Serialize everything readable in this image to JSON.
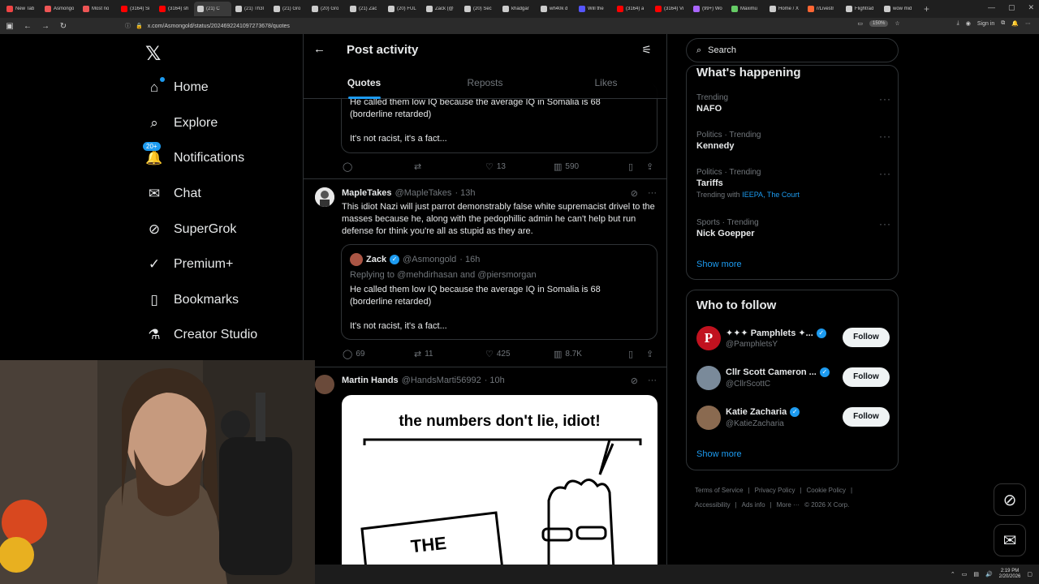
{
  "browser": {
    "tabs": [
      {
        "title": "New Tab",
        "color": "#e44"
      },
      {
        "title": "Asmongo",
        "color": "#e55"
      },
      {
        "title": "Most no",
        "color": "#e55"
      },
      {
        "title": "(3164) Si",
        "color": "#f00"
      },
      {
        "title": "(3164) sh",
        "color": "#f00"
      },
      {
        "title": "(21) C",
        "color": "#ccc",
        "active": true
      },
      {
        "title": "(21) Th3l",
        "color": "#ccc"
      },
      {
        "title": "(21) Gro",
        "color": "#ccc"
      },
      {
        "title": "(20) Gro",
        "color": "#ccc"
      },
      {
        "title": "(21) Zac",
        "color": "#ccc"
      },
      {
        "title": "(20) FUL",
        "color": "#ccc"
      },
      {
        "title": "Zack (@",
        "color": "#ccc"
      },
      {
        "title": "(20) Sec",
        "color": "#ccc"
      },
      {
        "title": "khadgar",
        "color": "#ccc"
      },
      {
        "title": "wh40k d",
        "color": "#ccc"
      },
      {
        "title": "Will the",
        "color": "#55f"
      },
      {
        "title": "(3164) a",
        "color": "#f00"
      },
      {
        "title": "(3164) Vi",
        "color": "#f00"
      },
      {
        "title": "(99+) Wo",
        "color": "#a6f"
      },
      {
        "title": "Maximu",
        "color": "#6c6"
      },
      {
        "title": "Home / X",
        "color": "#ccc"
      },
      {
        "title": "r/Livestr",
        "color": "#f63"
      },
      {
        "title": "Flightrad",
        "color": "#ccc"
      },
      {
        "title": "wow mid",
        "color": "#ccc"
      }
    ],
    "url": "x.com/Asmongold/status/2024692241097273678/quotes",
    "zoom": "150%",
    "sign_in": "Sign in"
  },
  "nav": {
    "home": "Home",
    "explore": "Explore",
    "notifications": "Notifications",
    "notifications_badge": "20+",
    "chat": "Chat",
    "supergrok": "SuperGrok",
    "premium": "Premium+",
    "bookmarks": "Bookmarks",
    "creator_studio": "Creator Studio"
  },
  "header": {
    "title": "Post activity",
    "tabs": [
      "Quotes",
      "Reposts",
      "Likes"
    ]
  },
  "tweets": {
    "top_quote": {
      "text1": "He called them low IQ because the average IQ in Somalia is 68",
      "text2": "(borderline retarded)",
      "text3": "It's not racist, it's a fact...",
      "likes": "13",
      "views": "590"
    },
    "t1": {
      "name": "MapleTakes",
      "handle": "@MapleTakes",
      "time": "· 13h",
      "body": "This idiot Nazi will just parrot demonstrably false white supremacist drivel to the masses because he, along with the pedophillic admin he can't help but run defense for think you're all as stupid as they are.",
      "quote": {
        "name": "Zack",
        "handle": "@Asmongold",
        "time": "· 16h",
        "replying": "Replying to @mehdirhasan and @piersmorgan",
        "text1": "He called them low IQ because the average IQ in Somalia is 68",
        "text2": "(borderline retarded)",
        "text3": "It's not racist, it's a fact..."
      },
      "replies": "69",
      "reposts": "11",
      "likes": "425",
      "views": "8.7K"
    },
    "t2": {
      "name": "Martin Hands",
      "handle": "@HandsMarti56992",
      "time": "· 10h",
      "meme_caption": "the numbers don't lie, idiot!",
      "meme_sign": "THE"
    }
  },
  "right": {
    "search_placeholder": "Search",
    "happening_title": "What's happening",
    "trends": [
      {
        "meta": "Trending",
        "name": "NAFO"
      },
      {
        "meta": "Politics · Trending",
        "name": "Kennedy"
      },
      {
        "meta": "Politics · Trending",
        "name": "Tariffs",
        "with_label": "Trending with",
        "with_links": "IEEPA, The Court"
      },
      {
        "meta": "Sports · Trending",
        "name": "Nick Goepper"
      }
    ],
    "show_more": "Show more",
    "follow_title": "Who to follow",
    "follows": [
      {
        "name": "✦✦✦ Pamphlets ✦...",
        "handle": "@PamphletsY",
        "button": "Follow"
      },
      {
        "name": "Cllr Scott Cameron ...",
        "handle": "@CllrScottC",
        "button": "Follow"
      },
      {
        "name": "Katie Zacharia",
        "handle": "@KatieZacharia",
        "button": "Follow"
      }
    ],
    "follow_show_more": "Show more",
    "footer": [
      "Terms of Service",
      "|",
      "Privacy Policy",
      "|",
      "Cookie Policy",
      "|",
      "Accessibility",
      "|",
      "Ads info",
      "|",
      "More ···",
      "© 2026 X Corp."
    ]
  },
  "taskbar": {
    "time": "2:19 PM",
    "date": "2/20/2026"
  }
}
